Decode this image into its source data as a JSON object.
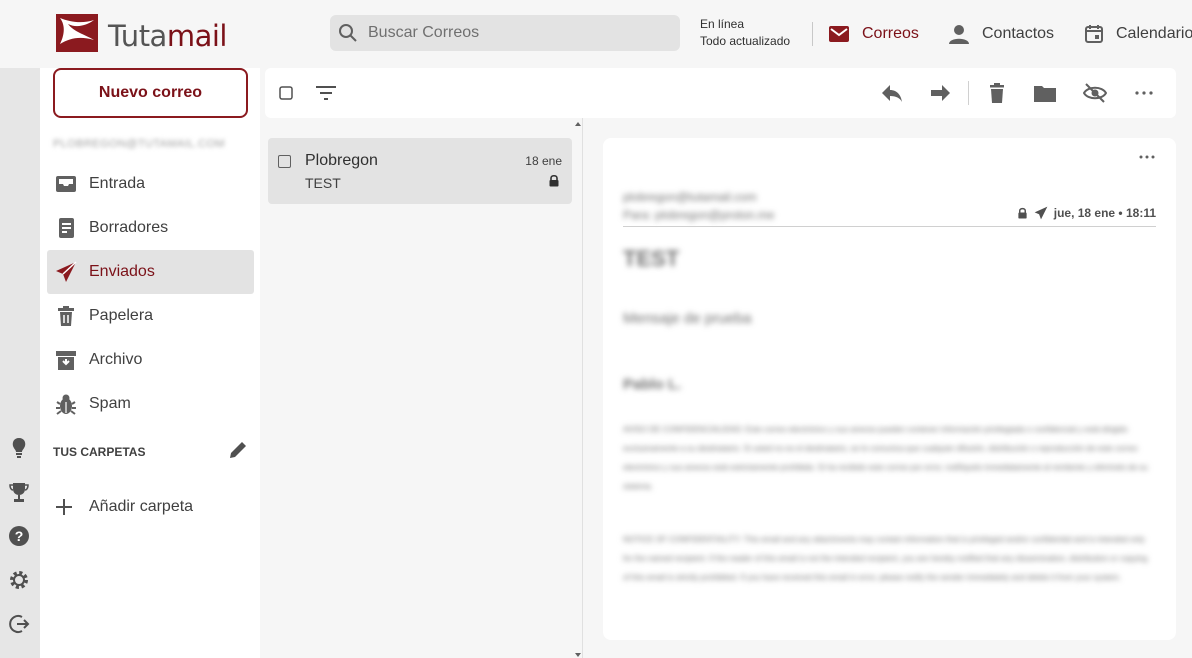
{
  "app": {
    "logo_text_part1": "Tuta",
    "logo_text_part2": "mail",
    "brand_color": "#8b1a1f"
  },
  "search": {
    "placeholder": "Buscar Correos"
  },
  "status": {
    "line1": "En línea",
    "line2": "Todo actualizado"
  },
  "nav": {
    "mail": "Correos",
    "contacts": "Contactos",
    "calendar": "Calendario"
  },
  "sidebar": {
    "new_mail": "Nuevo correo",
    "account": "PLOBREGON@TUTAMAIL.COM",
    "folders": [
      {
        "label": "Entrada",
        "icon": "inbox-icon"
      },
      {
        "label": "Borradores",
        "icon": "draft-icon"
      },
      {
        "label": "Enviados",
        "icon": "send-icon"
      },
      {
        "label": "Papelera",
        "icon": "trash-icon"
      },
      {
        "label": "Archivo",
        "icon": "archive-icon"
      },
      {
        "label": "Spam",
        "icon": "bug-icon"
      }
    ],
    "section_title": "TUS CARPETAS",
    "add_folder": "Añadir carpeta"
  },
  "mail_list": {
    "items": [
      {
        "sender": "Plobregon",
        "date": "18 ene",
        "subject": "TEST"
      }
    ]
  },
  "reader": {
    "from": "plobregon@tutamail.com",
    "to": "Para: plobregon@proton.me",
    "date": "jue, 18 ene • 18:11",
    "subject": "TEST",
    "body_line": "Mensaje de prueba",
    "signature": "Pablo L.",
    "para1": "AVISO DE CONFIDENCIALIDAD: Este correo electrónico y sus anexos pueden contener información privilegiada o confidencial y está dirigido exclusivamente a su destinatario. Si usted no es el destinatario, se le comunica que cualquier difusión, distribución o reproducción de este correo electrónico y sus anexos está estrictamente prohibida. Si ha recibido este correo por error, notifíquelo inmediatamente al remitente y elimínelo de su sistema.",
    "para2": "NOTICE OF CONFIDENTIALITY: This email and any attachments may contain information that is privileged and/or confidential and is intended only for the named recipient. If the reader of this email is not the intended recipient, you are hereby notified that any dissemination, distribution or copying of this email is strictly prohibited. If you have received this email in error, please notify the sender immediately and delete it from your system."
  }
}
